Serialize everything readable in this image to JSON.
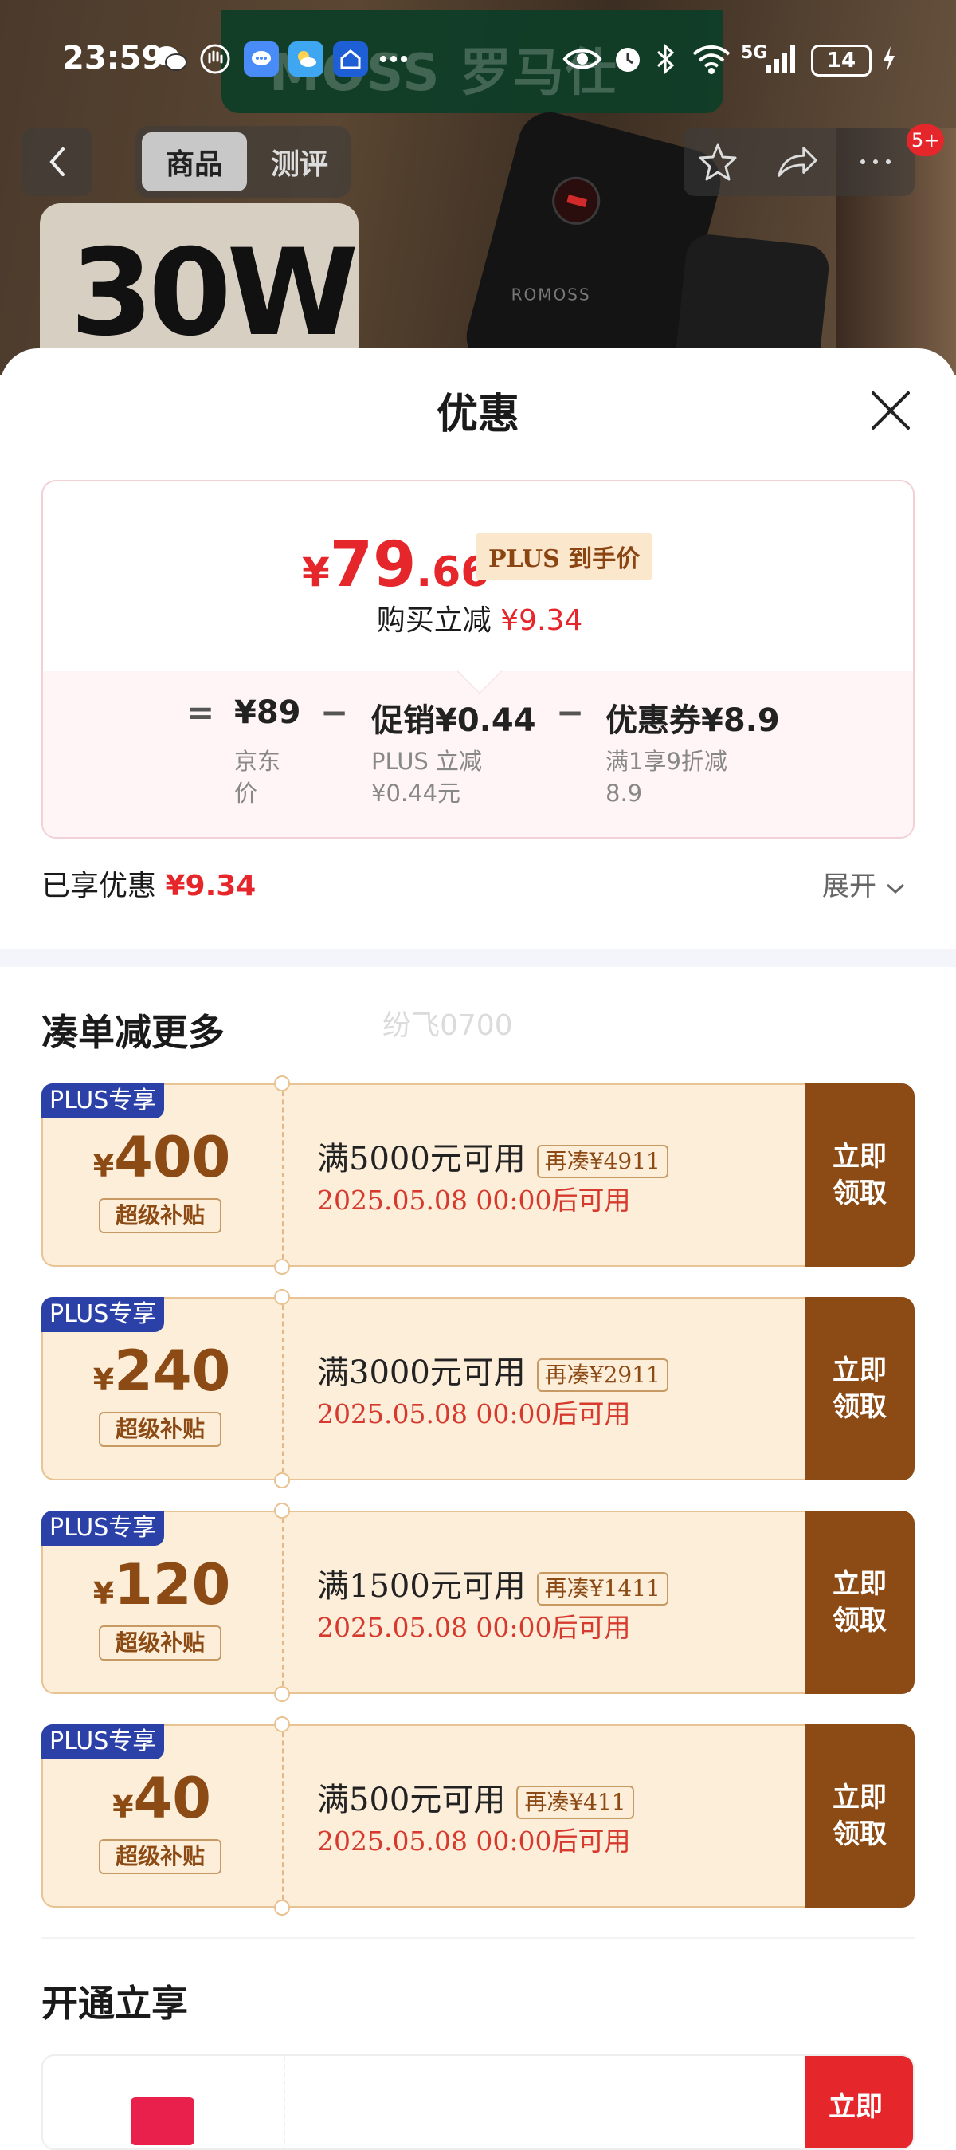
{
  "status_bar": {
    "time": "23:59",
    "network": "5G",
    "battery": "14"
  },
  "background": {
    "ad_logo": "MOSS 罗马仕",
    "promo_text": "30W",
    "product_brand": "ROMOSS"
  },
  "nav": {
    "tabs": [
      "商品",
      "测评"
    ],
    "notification_badge": "5+"
  },
  "sheet": {
    "title": "优惠",
    "price": {
      "currency": "¥",
      "integer": "79",
      "decimal": ".66",
      "tag": "PLUS 到手价",
      "reduce_label": "购买立减",
      "reduce_value": "¥9.34"
    },
    "formula": {
      "equals": "=",
      "minus": "−",
      "jd_value": "¥89",
      "jd_sub": [
        "京东",
        "价"
      ],
      "promo_value": "促销¥0.44",
      "promo_sub": [
        "PLUS 立减",
        "¥0.44元"
      ],
      "coupon_value": "优惠券¥8.9",
      "coupon_sub": [
        "满1享9折减",
        "8.9"
      ]
    },
    "enjoyed_label": "已享优惠",
    "enjoyed_value": "¥9.34",
    "expand_label": "展开"
  },
  "section_more": {
    "title": "凑单减更多",
    "watermark": "纷飞0700",
    "coupons": [
      {
        "badge": "PLUS专享",
        "currency": "¥",
        "amount": "400",
        "tag": "超级补贴",
        "condition": "满5000元可用",
        "extra": "再凑¥4911",
        "date": "2025.05.08 00:00后可用",
        "action": "立即领取"
      },
      {
        "badge": "PLUS专享",
        "currency": "¥",
        "amount": "240",
        "tag": "超级补贴",
        "condition": "满3000元可用",
        "extra": "再凑¥2911",
        "date": "2025.05.08 00:00后可用",
        "action": "立即领取"
      },
      {
        "badge": "PLUS专享",
        "currency": "¥",
        "amount": "120",
        "tag": "超级补贴",
        "condition": "满1500元可用",
        "extra": "再凑¥1411",
        "date": "2025.05.08 00:00后可用",
        "action": "立即领取"
      },
      {
        "badge": "PLUS专享",
        "currency": "¥",
        "amount": "40",
        "tag": "超级补贴",
        "condition": "满500元可用",
        "extra": "再凑¥411",
        "date": "2025.05.08 00:00后可用",
        "action": "立即领取"
      }
    ]
  },
  "section_open": {
    "title": "开通立享",
    "button": "立即"
  }
}
